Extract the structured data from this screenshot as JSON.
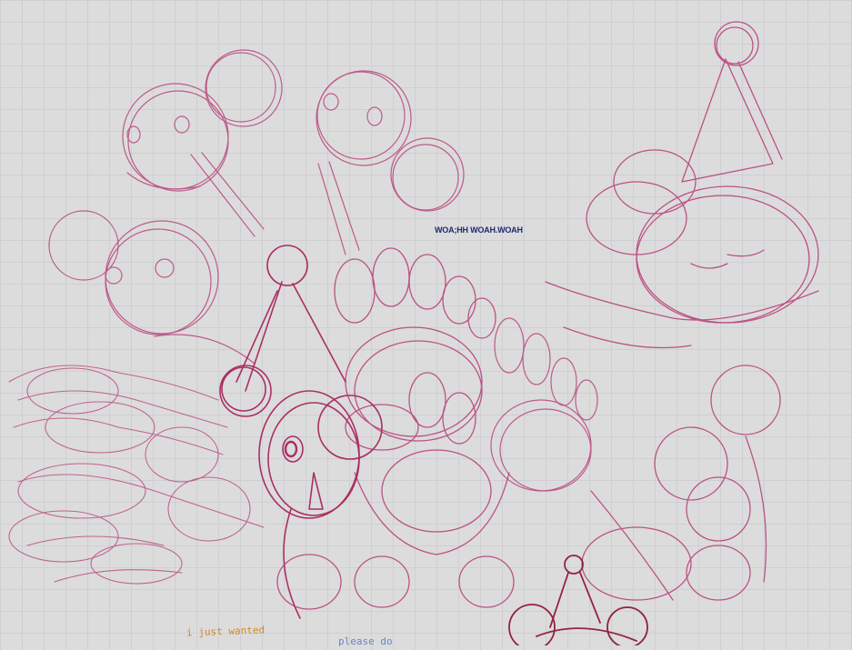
{
  "canvas": {
    "background": "#dcdcdc",
    "grid_color": "#cfcfd3",
    "stroke_primary": "#b3306f",
    "stroke_secondary": "#c8739e",
    "stroke_dark": "#8a1230"
  },
  "caption": {
    "text": "WOA;HH WOAH.WOAH",
    "color": "#1e2a6e"
  },
  "notes": {
    "orange_text": "i just wanted",
    "orange_color": "#d08a2a",
    "blue_text": "please do",
    "blue_color": "#6b82c8"
  }
}
